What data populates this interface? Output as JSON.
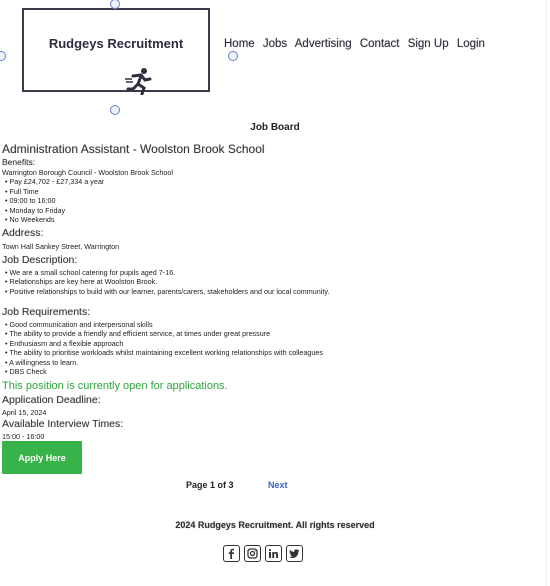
{
  "logo": {
    "text": "Rudgeys Recruitment"
  },
  "nav": [
    "Home",
    "Jobs",
    "Advertising",
    "Contact",
    "Sign Up",
    "Login"
  ],
  "board_title": "Job Board",
  "job": {
    "title": "Administration Assistant - Woolston Brook School",
    "benefits_heading": "Benefits:",
    "employer": "Warrington Borough Council - Woolston Brook School",
    "benefits": [
      "Pay £24,702 - £27,334 a year",
      "Full Time",
      "09:00 to 16:00",
      "Monday to Friday",
      "No Weekends"
    ],
    "address_heading": "Address:",
    "address": "Town Hall Sankey Street, Warrington",
    "description_heading": "Job Description:",
    "description": [
      "We are a small school catering for pupils aged 7-16.",
      "Relationships are key here at Woolston Brook.",
      "Positive relationships to build with our learner, parents/carers, stakeholders and our local community."
    ],
    "requirements_heading": "Job Requirements:",
    "requirements": [
      "Good communication and interpersonal skills",
      "The ability to provide a friendly and efficient service, at times under great pressure",
      "Enthusiasm and a flexible approach",
      "The ability to prioritise workloads whilst maintaining excellent working relationships with colleagues",
      "A willingness to learn.",
      "DBS Check"
    ],
    "status": "This position is currently open for applications.",
    "deadline_heading": "Application Deadline:",
    "deadline": "April 15, 2024",
    "interview_heading": "Available Interview Times:",
    "interview": "15:00 - 16:00"
  },
  "apply_label": "Apply Here",
  "pager": {
    "label": "Page 1 of 3",
    "next": "Next"
  },
  "footer": "2024 Rudgeys Recruitment. All rights reserved",
  "social_icons": [
    "facebook-icon",
    "instagram-icon",
    "linkedin-icon",
    "twitter-icon"
  ],
  "colors": {
    "accent_green": "#37b34a",
    "status_green": "#2fa33e",
    "link_blue": "#3a62c9"
  }
}
